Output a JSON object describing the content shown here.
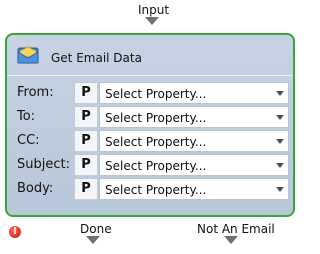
{
  "connectors": {
    "input_label": "Input",
    "output_done_label": "Done",
    "output_not_email_label": "Not An Email"
  },
  "node": {
    "title": "Get Email Data",
    "icon": "email-icon",
    "border_color": "#3aa53a",
    "fields": [
      {
        "label": "From:",
        "badge": "P",
        "value": "Select Property..."
      },
      {
        "label": "To:",
        "badge": "P",
        "value": "Select Property..."
      },
      {
        "label": "CC:",
        "badge": "P",
        "value": "Select Property..."
      },
      {
        "label": "Subject:",
        "badge": "P",
        "value": "Select Property..."
      },
      {
        "label": "Body:",
        "badge": "P",
        "value": "Select Property..."
      }
    ]
  },
  "status": {
    "error_icon": "error-icon",
    "error_glyph": "!"
  }
}
